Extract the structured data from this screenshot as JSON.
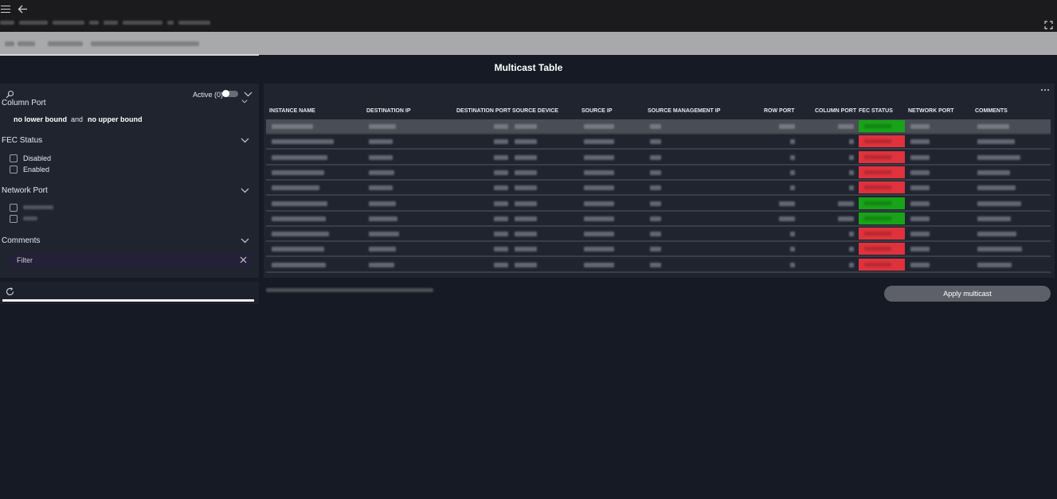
{
  "page": {
    "title": "Multicast Table"
  },
  "filters": {
    "active_label": "Active (0)",
    "active_toggle_on": false,
    "column_port": {
      "title": "Column Port",
      "lower": "no lower bound",
      "and": "and",
      "upper": "no upper bound"
    },
    "fec_status": {
      "title": "FEC Status",
      "options": [
        "Disabled",
        "Enabled"
      ]
    },
    "network_port": {
      "title": "Network Port"
    },
    "comments": {
      "title": "Comments",
      "filter_placeholder": "Filter"
    },
    "loading_progress": 1.0
  },
  "table": {
    "columns": [
      "INSTANCE NAME",
      "DESTINATION IP",
      "DESTINATION PORT",
      "SOURCE DEVICE",
      "SOURCE IP",
      "SOURCE MANAGEMENT IP",
      "ROW PORT",
      "COLUMN PORT",
      "FEC STATUS",
      "NETWORK PORT",
      "COMMENTS"
    ],
    "rows": [
      {
        "fec_status": "Enabled",
        "selected": true
      },
      {
        "fec_status": "Disabled",
        "selected": false
      },
      {
        "fec_status": "Disabled",
        "selected": false
      },
      {
        "fec_status": "Disabled",
        "selected": false
      },
      {
        "fec_status": "Disabled",
        "selected": false
      },
      {
        "fec_status": "Enabled",
        "selected": false
      },
      {
        "fec_status": "Enabled",
        "selected": false
      },
      {
        "fec_status": "Disabled",
        "selected": false
      },
      {
        "fec_status": "Disabled",
        "selected": false
      },
      {
        "fec_status": "Disabled",
        "selected": false
      }
    ]
  },
  "actions": {
    "apply_label": "Apply multicast"
  },
  "colors": {
    "background": "#161a24",
    "panel": "#20242f",
    "fec_enabled": "#18a318",
    "fec_disabled": "#e0323d",
    "button": "#5e6069"
  },
  "icons": [
    "menu-icon",
    "back-arrow-icon",
    "fullscreen-icon",
    "search-icon",
    "chevron-down-icon",
    "close-icon",
    "refresh-icon",
    "more-options-icon"
  ]
}
